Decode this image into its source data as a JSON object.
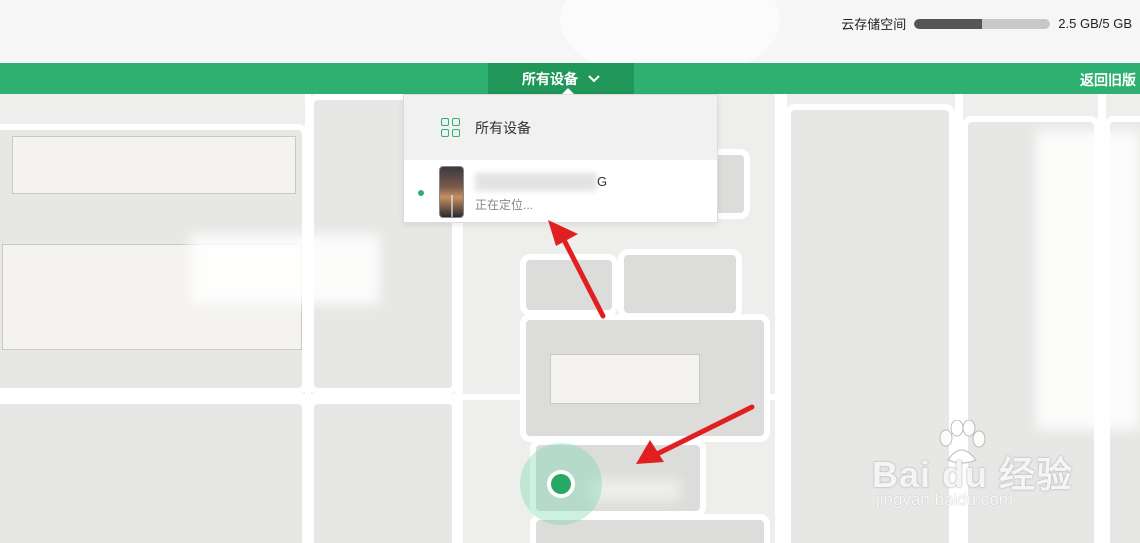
{
  "storage": {
    "label": "云存储空间",
    "used_fraction": 0.5,
    "value": "2.5 GB/5 GB"
  },
  "nav": {
    "device_selector_label": "所有设备",
    "back_link": "返回旧版"
  },
  "dropdown": {
    "all_devices_label": "所有设备",
    "device": {
      "name_visible_suffix": "G",
      "status": "正在定位..."
    }
  },
  "watermark": {
    "brand": "Bai du 经验",
    "url": "jingyan.baidu.com"
  },
  "colors": {
    "brand_green": "#2db070",
    "selector_green": "#209658",
    "annotation_red": "#e02020"
  }
}
